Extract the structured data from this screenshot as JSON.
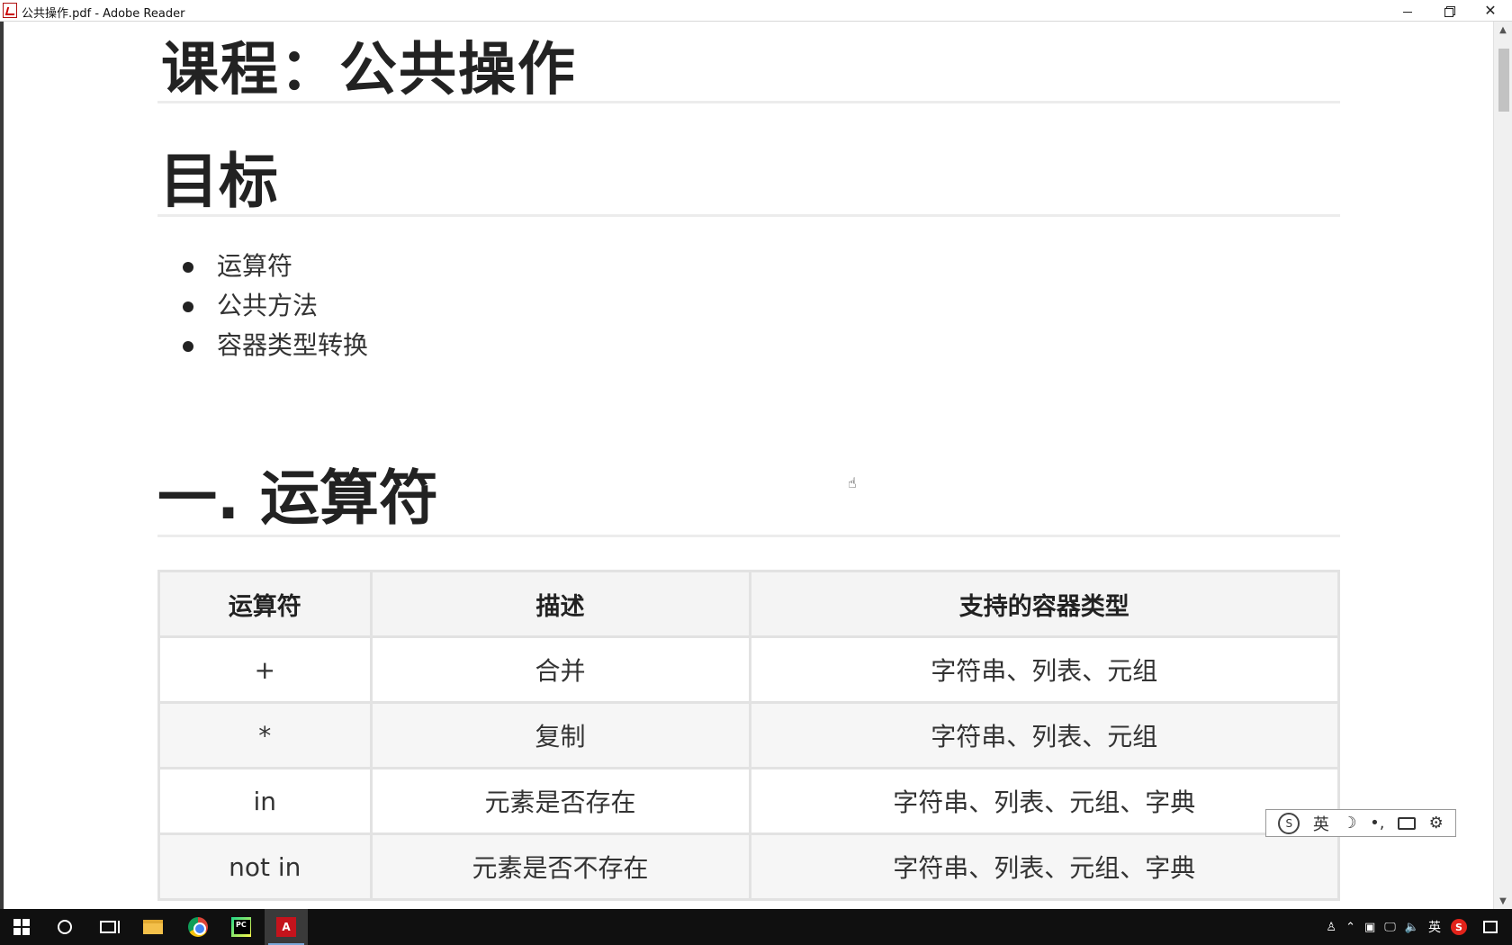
{
  "window": {
    "title": "公共操作.pdf - Adobe Reader"
  },
  "document": {
    "course_title": "课程：公共操作",
    "goals_heading": "目标",
    "goals": [
      "运算符",
      "公共方法",
      "容器类型转换"
    ],
    "section1_heading": "一. 运算符",
    "operator_table": {
      "headers": [
        "运算符",
        "描述",
        "支持的容器类型"
      ],
      "rows": [
        [
          "+",
          "合并",
          "字符串、列表、元组"
        ],
        [
          "*",
          "复制",
          "字符串、列表、元组"
        ],
        [
          "in",
          "元素是否存在",
          "字符串、列表、元组、字典"
        ],
        [
          "not in",
          "元素是否不存在",
          "字符串、列表、元组、字典"
        ]
      ]
    }
  },
  "ime_bar": {
    "mode": "英",
    "icons": [
      "sogou-logo-icon",
      "moon-icon",
      "punctuation-icon",
      "keyboard-icon",
      "gear-icon"
    ]
  },
  "taskbar": {
    "apps": [
      "start-icon",
      "cortana-icon",
      "task-view-icon",
      "file-explorer-icon",
      "chrome-icon",
      "pycharm-icon",
      "adobe-reader-icon"
    ],
    "tray": {
      "input_lang": "英"
    }
  }
}
